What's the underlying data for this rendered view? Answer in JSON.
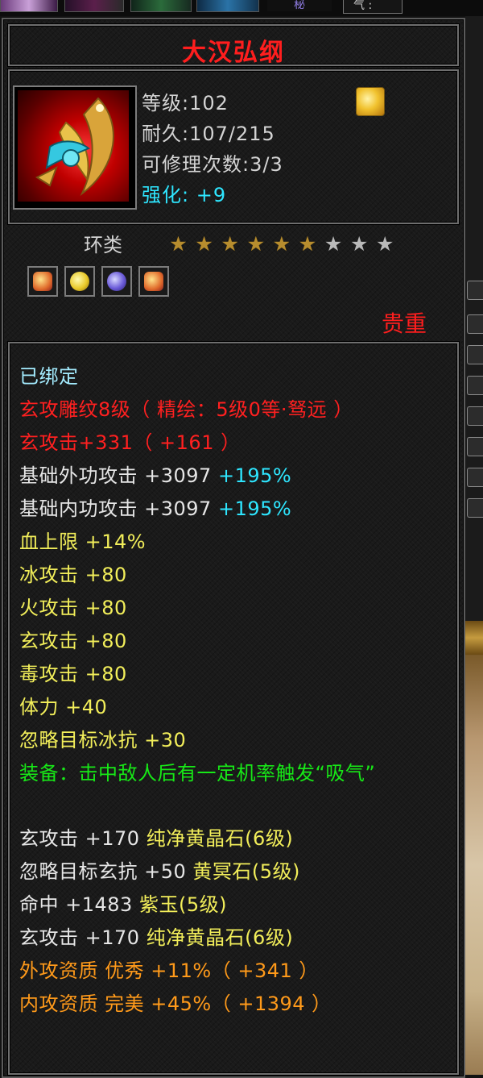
{
  "topbar": {
    "tab_partial_text": "秘",
    "tab_right_text": "气 :"
  },
  "item": {
    "name": "大汉弘纲",
    "icon": "red-weapon-icon",
    "level_label": "等级:102",
    "durability_label": "耐久:107/215",
    "repair_label": "可修理次数:3/3",
    "enhance_label": "强化:",
    "enhance_value": "+9",
    "badge_icon": "gold-gem-badge-icon",
    "category": "环类",
    "stars_total": 9,
    "stars_filled": 6,
    "sockets": [
      "orange-gem-icon",
      "yellow-gem-icon",
      "purple-gem-icon",
      "orange-gem-icon"
    ],
    "rarity": "贵重"
  },
  "attributes": {
    "bound": "已绑定",
    "engrave": "玄攻雕纹8级（ 精绘：5级0等·驽远 ）",
    "xuan_attack": "玄攻击+331（ +161 ）",
    "ext_attack_label": "基础外功攻击 +3097",
    "ext_attack_pct": "+195%",
    "int_attack_label": "基础内功攻击 +3097",
    "int_attack_pct": "+195%",
    "hp_label": "血上限",
    "hp_value": "+14%",
    "ice_label": "冰攻击",
    "ice_value": "+80",
    "fire_label": "火攻击",
    "fire_value": "+80",
    "xuan_label": "玄攻击",
    "xuan_value": "+80",
    "poison_label": "毒攻击",
    "poison_value": "+80",
    "stamina_label": "体力",
    "stamina_value": "+40",
    "ignore_ice_label": "忽略目标冰抗",
    "ignore_ice_value": "+30",
    "equip_effect": "装备：击中敌人后有一定机率触发“吸气”",
    "gem1_stat": "玄攻击 +170",
    "gem1_name": "纯净黄晶石(6级)",
    "gem2_stat": "忽略目标玄抗 +50",
    "gem2_name": "黄冥石(5级)",
    "gem3_stat": "命中 +1483",
    "gem3_name": "紫玉(5级)",
    "gem4_stat": "玄攻击 +170",
    "gem4_name": "纯净黄晶石(6级)",
    "ext_aptitude": "外攻资质  优秀 +11%（ +341 ）",
    "int_aptitude": "内攻资质  完美 +45%（ +1394 ）"
  },
  "colors": {
    "title": "#ff1e1e",
    "bound": "#a4ecff",
    "engrave": "#ff2020",
    "base": "#e6e6e6",
    "percent": "#2ee6ff",
    "bonus": "#f2ee5a",
    "effect": "#17e817",
    "aptitude": "#ff9a1a",
    "star_on": "#b78d2e",
    "star_off": "#b9b9b9"
  }
}
